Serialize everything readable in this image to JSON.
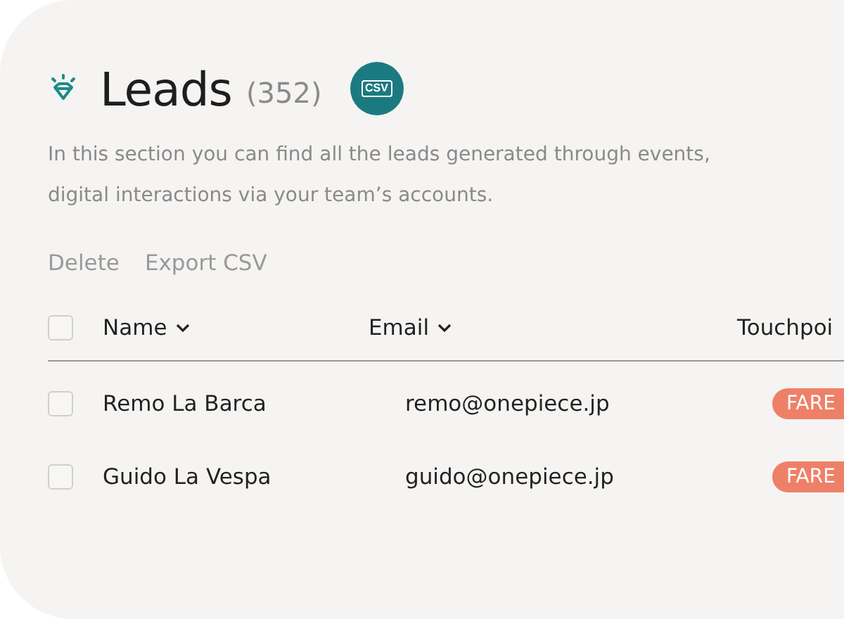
{
  "header": {
    "title": "Leads",
    "count": "(352)",
    "csv_button": "CSV"
  },
  "description": "In this section you can find all the leads generated through events, digital interactions via your team’s accounts.",
  "actions": [
    "Delete",
    "Export CSV"
  ],
  "table": {
    "select_all": {
      "checked": false
    },
    "columns": [
      {
        "label": "Name",
        "sortable": true
      },
      {
        "label": "Email",
        "sortable": true
      },
      {
        "label": "Touchpoi",
        "sortable": false
      }
    ],
    "rows": [
      {
        "checked": false,
        "name": "Remo La Barca",
        "email": "remo@onepiece.jp",
        "touchpoint": "FARE"
      },
      {
        "checked": false,
        "name": "Guido La Vespa",
        "email": "guido@onepiece.jp",
        "touchpoint": "FARE"
      }
    ]
  }
}
